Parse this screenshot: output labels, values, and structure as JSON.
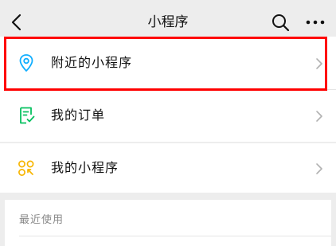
{
  "header": {
    "title": "小程序",
    "back_icon": "chevron-left-icon",
    "search_icon": "search-icon",
    "more_icon": "more-dots-icon"
  },
  "rows": [
    {
      "label": "附近的小程序",
      "icon": "location-pin-icon",
      "icon_color": "#10aeff"
    },
    {
      "label": "我的订单",
      "icon": "order-list-icon",
      "icon_color": "#07c160"
    },
    {
      "label": "我的小程序",
      "icon": "mini-program-grid-icon",
      "icon_color": "#f7b500"
    }
  ],
  "recent": {
    "label": "最近使用"
  },
  "colors": {
    "highlight_border": "#ff0000",
    "background": "#ededed"
  }
}
